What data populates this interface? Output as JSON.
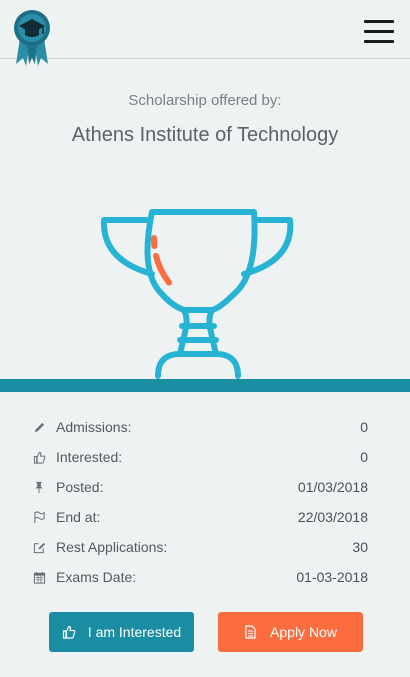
{
  "header": {
    "logo_icon": "scholarship-award-logo-icon",
    "menu_icon": "hamburger-menu-icon"
  },
  "scholarship": {
    "offered_by_label": "Scholarship offered by:",
    "institute_name": "Athens Institute of Technology",
    "illustration_icon": "trophy-icon"
  },
  "details": {
    "rows": [
      {
        "icon": "pencil-icon",
        "label": "Admissions:",
        "value": "0"
      },
      {
        "icon": "thumbs-up-icon",
        "label": "Interested:",
        "value": "0"
      },
      {
        "icon": "pin-icon",
        "label": "Posted:",
        "value": "01/03/2018"
      },
      {
        "icon": "flag-icon",
        "label": "End at:",
        "value": "22/03/2018"
      },
      {
        "icon": "edit-icon",
        "label": "Rest Applications:",
        "value": "30"
      },
      {
        "icon": "calendar-icon",
        "label": "Exams Date:",
        "value": "01-03-2018"
      }
    ]
  },
  "actions": {
    "interested_label": "I am Interested",
    "apply_label": "Apply Now"
  },
  "colors": {
    "accent_teal": "#1b8da2",
    "accent_orange": "#fb6c3f",
    "trophy_blue": "#27b3d4",
    "background": "#eff2f3"
  }
}
